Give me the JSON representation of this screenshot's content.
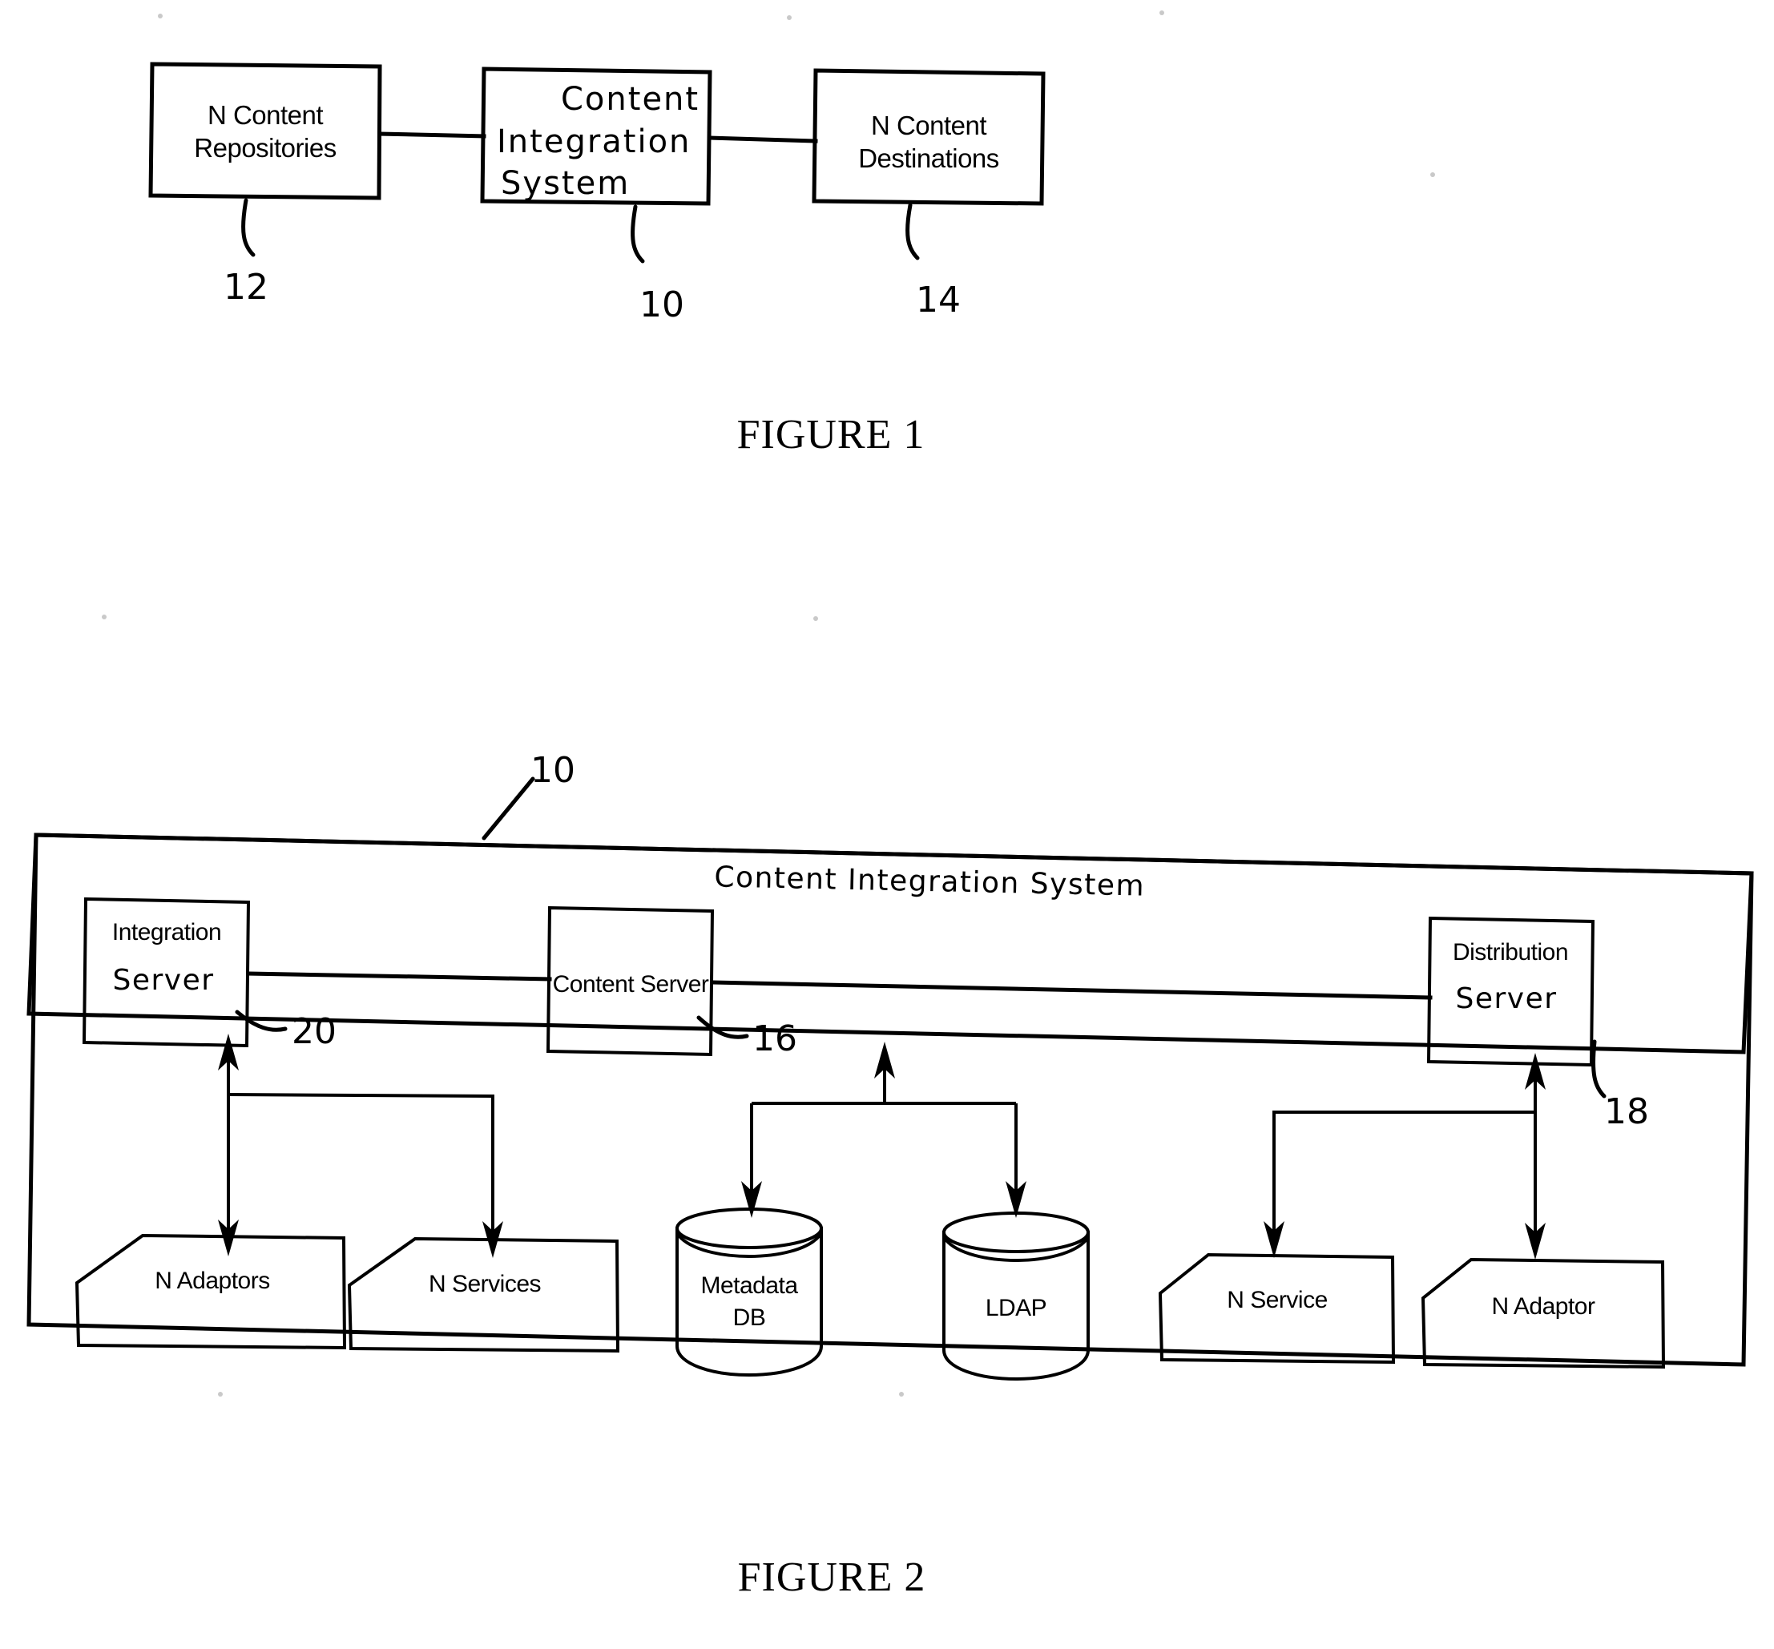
{
  "document": {
    "type": "patent-drawing-sheet",
    "ink_color": "#000000",
    "background_color": "#ffffff"
  },
  "figure1": {
    "caption": "FIGURE 1",
    "blocks": [
      {
        "id": "content-repositories",
        "line1": "N Content",
        "line2": "Repositories",
        "style": "printed",
        "ref": "12"
      },
      {
        "id": "content-integration-system",
        "line1": "Content",
        "line2": "Integration",
        "line3": "System",
        "style": "handwritten",
        "ref": "10"
      },
      {
        "id": "content-destinations",
        "line1": "N Content",
        "line2": "Destinations",
        "style": "printed",
        "ref": "14"
      }
    ],
    "connectors": [
      {
        "from": "content-repositories",
        "to": "content-integration-system",
        "kind": "line"
      },
      {
        "from": "content-integration-system",
        "to": "content-destinations",
        "kind": "line"
      }
    ]
  },
  "figure2": {
    "caption": "FIGURE 2",
    "system_box": {
      "id": "content-integration-system",
      "label": "Content Integration System",
      "style": "handwritten",
      "ref": "10"
    },
    "servers": [
      {
        "id": "integration-server",
        "printed_line": "Integration",
        "handwritten_line": "Server",
        "ref": "20"
      },
      {
        "id": "content-server",
        "printed_line": "Content Server",
        "handwritten_line": "",
        "ref": "16"
      },
      {
        "id": "distribution-server",
        "printed_line": "Distribution",
        "handwritten_line": "Server",
        "ref": "18"
      }
    ],
    "leaf_nodes": [
      {
        "id": "n-adaptors",
        "label": "N Adaptors",
        "shape": "cut-corner-box",
        "parent": "integration-server",
        "arrow": "bidirectional"
      },
      {
        "id": "n-services",
        "label": "N Services",
        "shape": "cut-corner-box",
        "parent": "integration-server",
        "arrow": "down"
      },
      {
        "id": "metadata-db",
        "label_line1": "Metadata",
        "label_line2": "DB",
        "shape": "cylinder",
        "parent": "content-server",
        "arrow": "down"
      },
      {
        "id": "ldap",
        "label_line1": "LDAP",
        "label_line2": "",
        "shape": "cylinder",
        "parent": "content-server",
        "arrow": "down"
      },
      {
        "id": "n-service",
        "label": "N Service",
        "shape": "cut-corner-box",
        "parent": "distribution-server",
        "arrow": "down"
      },
      {
        "id": "n-adaptor",
        "label": "N Adaptor",
        "shape": "cut-corner-box",
        "parent": "distribution-server",
        "arrow": "bidirectional"
      }
    ],
    "bus_connectors": [
      {
        "from": "integration-server",
        "to": "content-server"
      },
      {
        "from": "content-server",
        "to": "distribution-server"
      }
    ]
  }
}
